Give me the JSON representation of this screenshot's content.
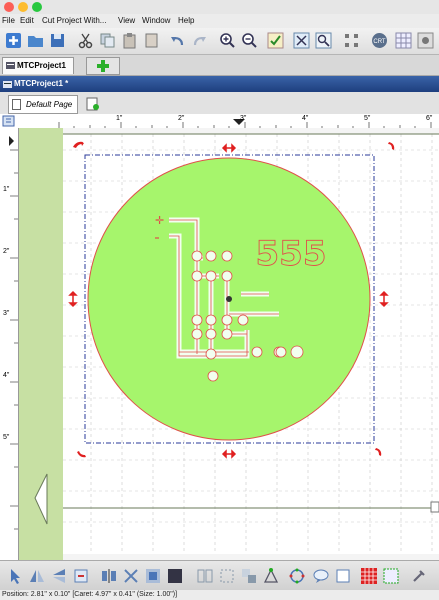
{
  "menu": [
    "File",
    "Edit",
    "Cut Project With...",
    "View",
    "Window",
    "Help"
  ],
  "project_tab": "MTCProject1",
  "window_title": "MTCProject1 *",
  "page_tab": "Default Page",
  "ruler_h_labels": [
    "1\"",
    "2\"",
    "3\"",
    "4\"",
    "5\"",
    "6\""
  ],
  "ruler_v_labels": [
    "1\"",
    "2\"",
    "3\"",
    "4\"",
    "5\""
  ],
  "design_text": "555",
  "status": "Position: 2.81\" x 0.10\" [Caret: 4.97\" x 0.41\" (Size: 1.00\")]",
  "colors": {
    "accent": "#a6f56c",
    "design_stroke": "#e0504a",
    "handle": "#e02020",
    "selection": "#2a3a9a"
  }
}
